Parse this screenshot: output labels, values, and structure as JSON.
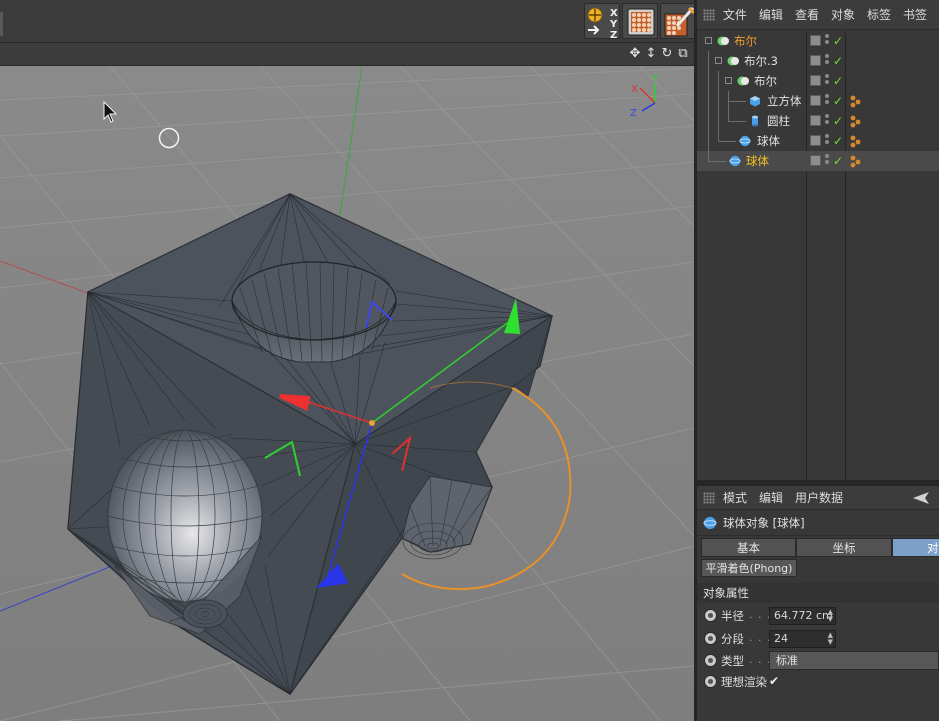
{
  "object_manager": {
    "menu": [
      "文件",
      "编辑",
      "查看",
      "对象",
      "标签",
      "书签"
    ],
    "objects": [
      {
        "name": "布尔",
        "color": "orange",
        "type": "boolean",
        "has_tag": false
      },
      {
        "name": "布尔.3",
        "color": "white",
        "type": "boolean",
        "has_tag": false
      },
      {
        "name": "布尔",
        "color": "white",
        "type": "boolean",
        "has_tag": false
      },
      {
        "name": "立方体",
        "color": "white",
        "type": "cube",
        "has_tag": true
      },
      {
        "name": "圆柱",
        "color": "white",
        "type": "cylinder",
        "has_tag": true
      },
      {
        "name": "球体",
        "color": "white",
        "type": "sphere",
        "has_tag": true
      },
      {
        "name": "球体",
        "color": "yellow",
        "type": "sphere",
        "has_tag": true
      }
    ]
  },
  "attribute_manager": {
    "menu": [
      "模式",
      "编辑",
      "用户数据"
    ],
    "object_title": "球体对象 [球体]",
    "tabs": [
      "基本",
      "坐标",
      "对象"
    ],
    "active_tab": "对象",
    "phong_button": "平滑着色(Phong)",
    "section_title": "对象属性",
    "params": {
      "radius": {
        "label": "半径",
        "value": "64.772 cm"
      },
      "segments": {
        "label": "分段",
        "value": "24"
      },
      "type": {
        "label": "类型",
        "value": "标准"
      },
      "ideal_render": {
        "label": "理想渲染",
        "checked": true
      }
    }
  },
  "viewport": {
    "axis_labels": {
      "x": "X",
      "y": "Y",
      "z": "Z"
    },
    "header_icons": [
      "move-view-icon",
      "dolly-view-icon",
      "rotate-view-icon",
      "toggle-view-icon"
    ]
  },
  "toolbar": {
    "icons": [
      "coordinate-system-icon",
      "render-view-icon",
      "render-settings-icon"
    ],
    "xyz_letters": [
      "X",
      "Y",
      "Z"
    ]
  },
  "colors": {
    "viewport_bg": "#8b8b8b",
    "mesh_face": "#4a5058",
    "x_axis": "#e23030",
    "y_axis": "#2fd42f",
    "z_axis": "#2a35e8",
    "selection_orange": "#f0a030",
    "active_tab": "#7da0c8"
  }
}
